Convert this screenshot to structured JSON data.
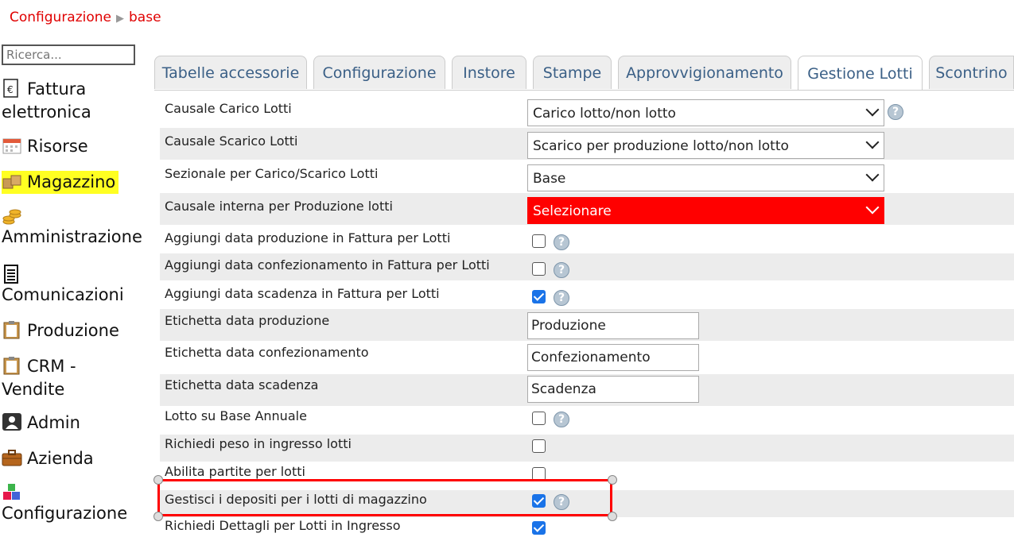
{
  "breadcrumb": {
    "root": "Configurazione",
    "separator": "▶",
    "current": "base"
  },
  "search": {
    "placeholder": "Ricerca..."
  },
  "sidebar": {
    "items": [
      {
        "label": "Fattura elettronica",
        "icon": "invoice-euro-icon"
      },
      {
        "label": "Risorse",
        "icon": "calendar-icon"
      },
      {
        "label": "Magazzino",
        "icon": "boxes-icon",
        "active": true
      },
      {
        "label": "Amministrazione",
        "icon": "coins-icon"
      },
      {
        "label": "Comunicazioni",
        "icon": "document-icon"
      },
      {
        "label": "Produzione",
        "icon": "clipboard-icon"
      },
      {
        "label": "CRM - Vendite",
        "icon": "clipboard-icon"
      },
      {
        "label": "Admin",
        "icon": "user-icon"
      },
      {
        "label": "Azienda",
        "icon": "briefcase-icon"
      },
      {
        "label": "Configurazione",
        "icon": "cubes-icon"
      }
    ]
  },
  "tabs": [
    {
      "label": "Tabelle accessorie"
    },
    {
      "label": "Configurazione"
    },
    {
      "label": "Instore"
    },
    {
      "label": "Stampe"
    },
    {
      "label": "Approvvigionamento"
    },
    {
      "label": "Gestione Lotti",
      "active": true
    },
    {
      "label": "Scontrino"
    }
  ],
  "form": {
    "causale_carico": {
      "label": "Causale Carico Lotti",
      "value": "Carico lotto/non lotto"
    },
    "causale_scarico": {
      "label": "Causale Scarico Lotti",
      "value": "Scarico per produzione lotto/non lotto"
    },
    "sezionale": {
      "label": "Sezionale per Carico/Scarico Lotti",
      "value": "Base"
    },
    "causale_interna": {
      "label": "Causale interna per Produzione lotti",
      "value": "Selezionare"
    },
    "data_produzione": {
      "label": "Aggiungi data produzione in Fattura per Lotti",
      "checked": false
    },
    "data_confezionamento": {
      "label": "Aggiungi data confezionamento in Fattura per Lotti",
      "checked": false
    },
    "data_scadenza": {
      "label": "Aggiungi data scadenza in Fattura per Lotti",
      "checked": true
    },
    "etichetta_produzione": {
      "label": "Etichetta data produzione",
      "value": "Produzione"
    },
    "etichetta_confezionamento": {
      "label": "Etichetta data confezionamento",
      "value": "Confezionamento"
    },
    "etichetta_scadenza": {
      "label": "Etichetta data scadenza",
      "value": "Scadenza"
    },
    "lotto_annuale": {
      "label": "Lotto su Base Annuale",
      "checked": false
    },
    "peso_ingresso": {
      "label": "Richiedi peso in ingresso lotti",
      "checked": false
    },
    "partite": {
      "label": "Abilita partite per lotti",
      "checked": false
    },
    "depositi": {
      "label": "Gestisci i depositi per i lotti di magazzino",
      "checked": true
    },
    "dettagli_ingresso": {
      "label": "Richiedi Dettagli per Lotti in Ingresso",
      "checked": true
    }
  },
  "help_glyph": "?",
  "colors": {
    "accent_red": "#ff0000",
    "tab_text": "#3a5f86",
    "highlight": "#ffff22",
    "checkbox": "#1a73e8"
  }
}
